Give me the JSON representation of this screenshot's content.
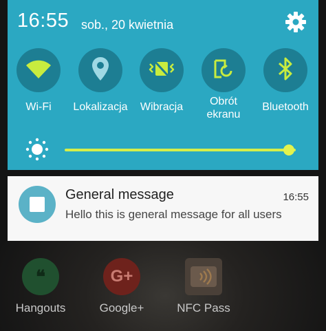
{
  "status": {
    "time": "16:55",
    "date": "sob., 20 kwietnia"
  },
  "quick_settings": [
    {
      "label": "Wi-Fi",
      "icon": "wifi-icon",
      "active": true
    },
    {
      "label": "Lokalizacja",
      "icon": "location-icon",
      "active": false
    },
    {
      "label": "Wibracja",
      "icon": "vibration-icon",
      "active": true
    },
    {
      "label": "Obrót\nekranu",
      "icon": "rotate-icon",
      "active": true
    },
    {
      "label": "Bluetooth",
      "icon": "bluetooth-icon",
      "active": true
    }
  ],
  "brightness": {
    "level": 0.97
  },
  "notification": {
    "title": "General message",
    "time": "16:55",
    "body": "Hello this is general message for all users"
  },
  "home_apps": [
    {
      "label": "Hangouts",
      "color": "#2c6b3e"
    },
    {
      "label": "Google+",
      "color": "#7a2a22"
    },
    {
      "label": "NFC Pass",
      "color": "#5a4a40"
    }
  ],
  "colors": {
    "panel": "#2ba8c2",
    "toggle_bg": "#1d7e93",
    "active_icon": "#c8ec3f",
    "inactive_icon": "#9fd9e4"
  }
}
